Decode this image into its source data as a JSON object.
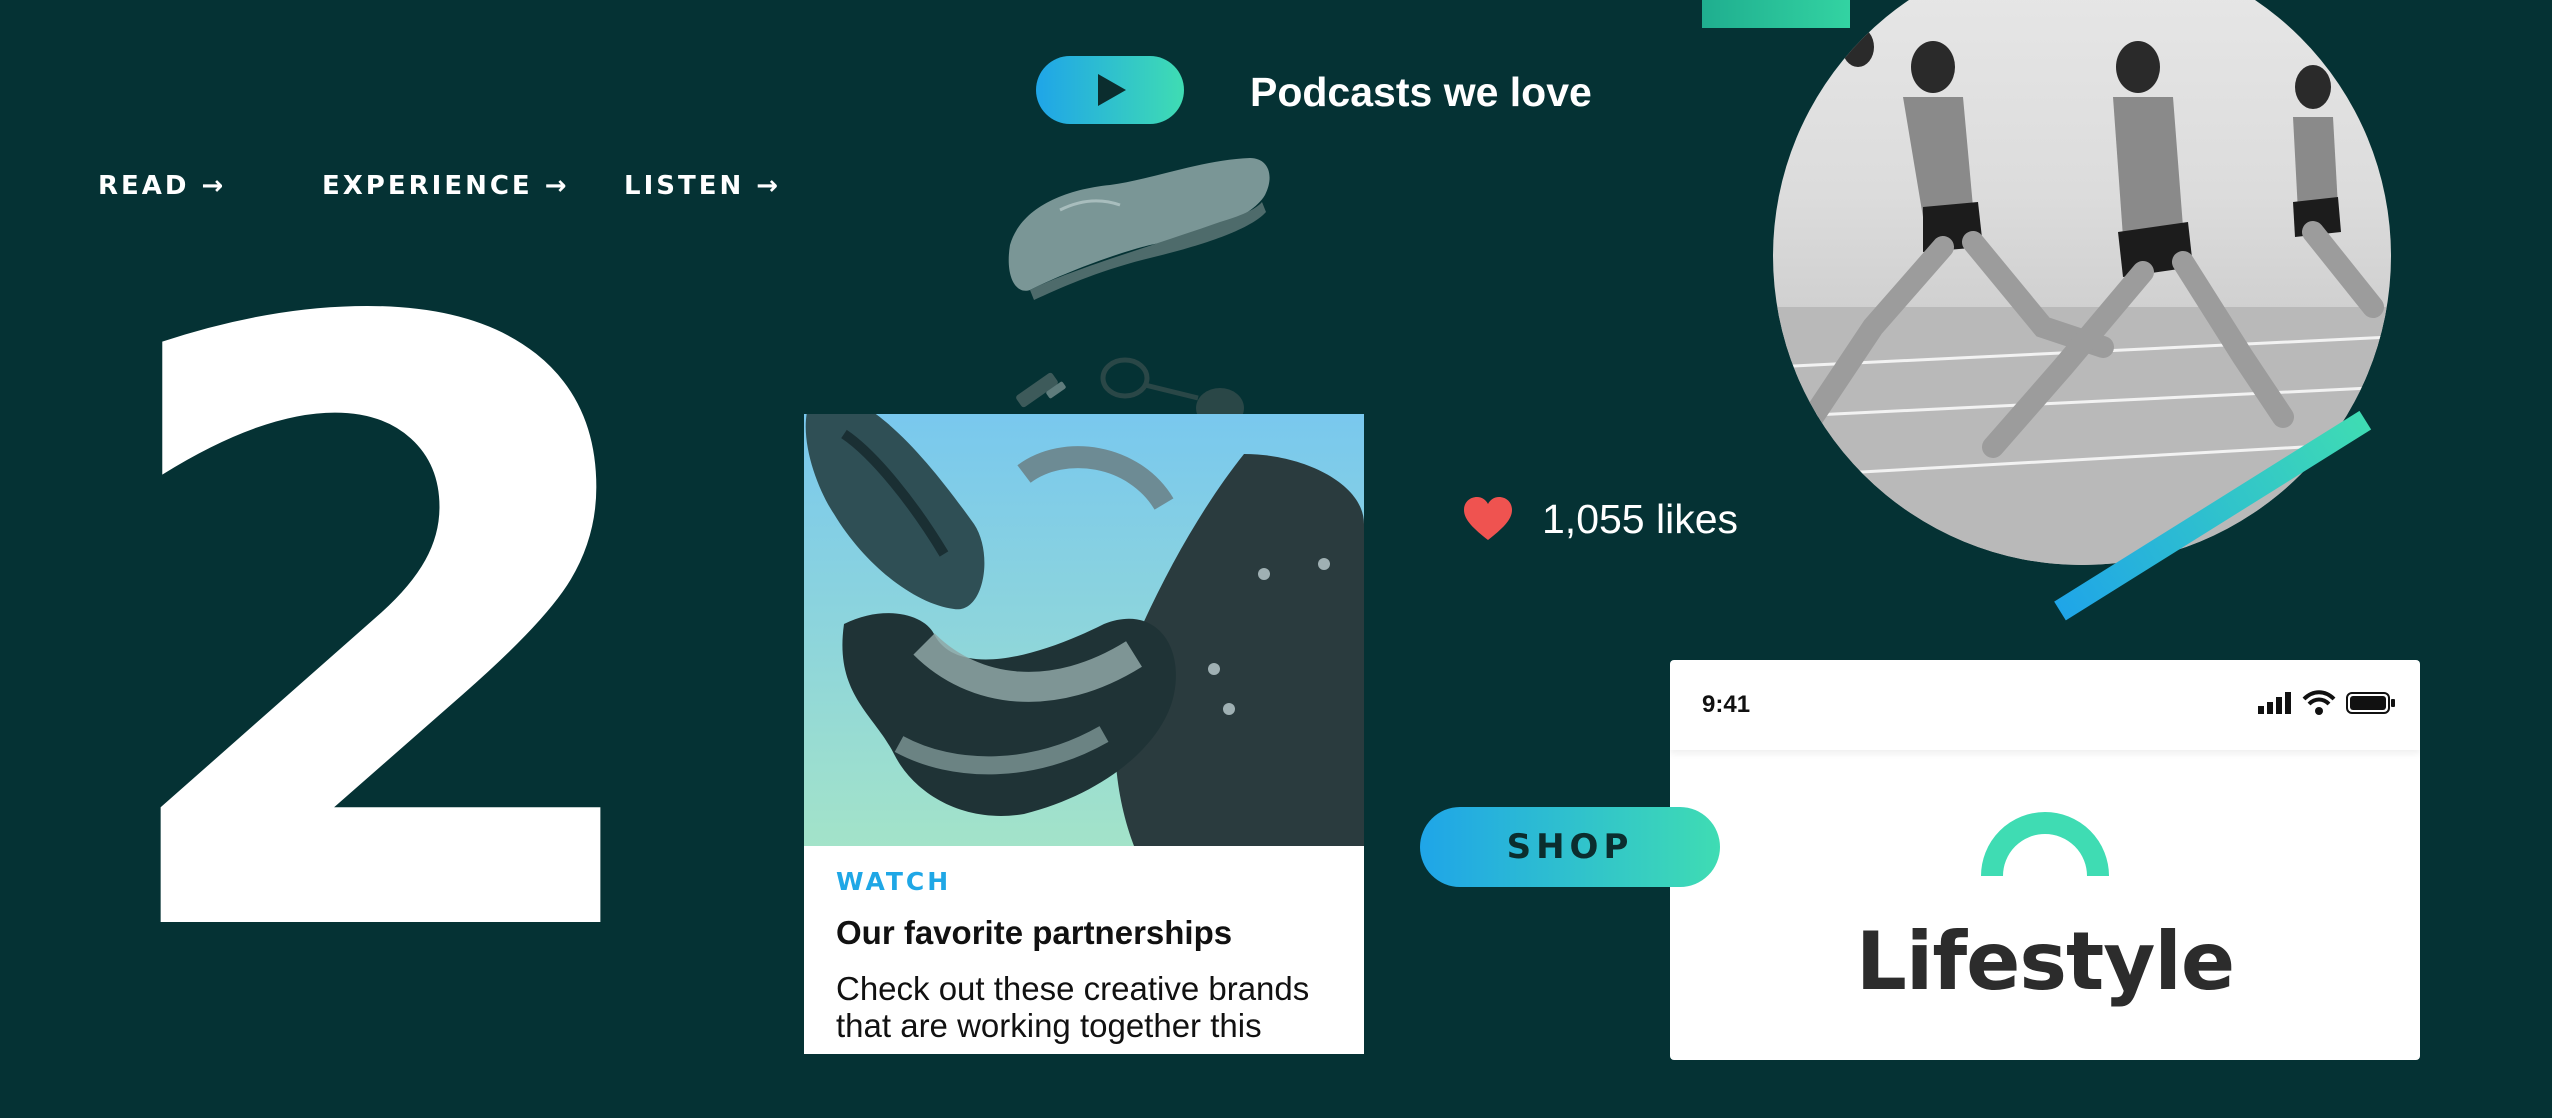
{
  "nav": {
    "items": [
      {
        "label": "READ",
        "arrow": "→"
      },
      {
        "label": "EXPERIENCE",
        "arrow": "→"
      },
      {
        "label": "LISTEN",
        "arrow": "→"
      }
    ]
  },
  "hero": {
    "number": "2"
  },
  "podcasts": {
    "label": "Podcasts we love",
    "icon": "play-icon"
  },
  "card": {
    "kicker": "WATCH",
    "title": "Our favorite partnerships",
    "body": "Check out these creative brands that are working together this"
  },
  "likes": {
    "text": "1,055 likes",
    "icon": "heart-icon"
  },
  "shop": {
    "label": "SHOP"
  },
  "phone": {
    "time": "9:41",
    "icons": [
      "signal-icon",
      "wifi-icon",
      "battery-icon"
    ],
    "title": "Lifestyle"
  },
  "colors": {
    "background": "#053234",
    "accent_blue": "#1fa5e8",
    "accent_green": "#3fdcb3",
    "heart": "#ef5350",
    "kicker": "#1fa7e6"
  }
}
